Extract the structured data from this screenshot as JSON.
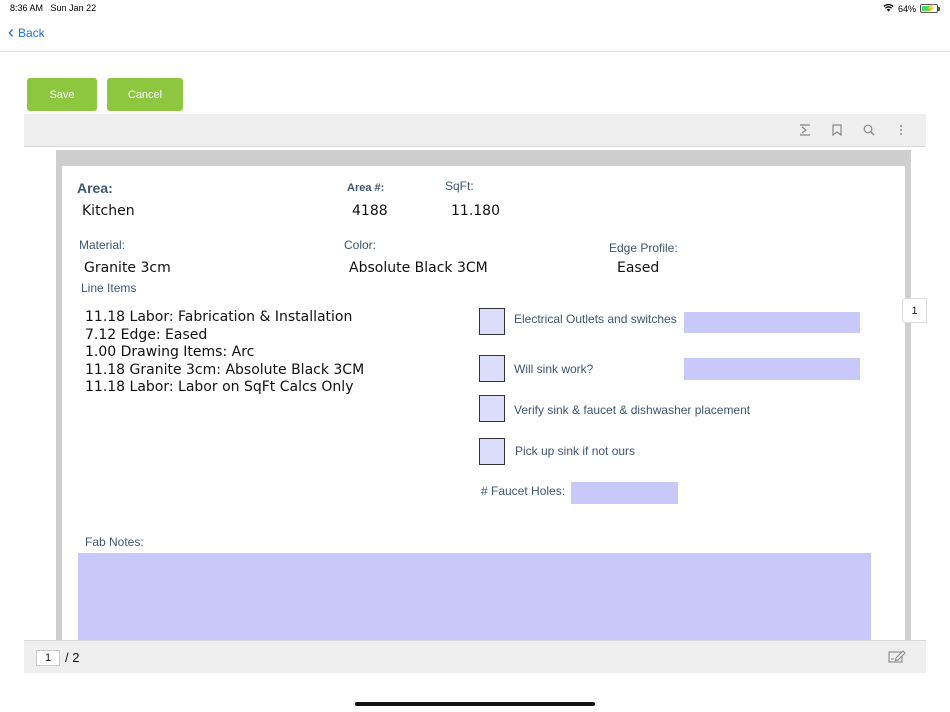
{
  "status_bar": {
    "time": "8:36 AM",
    "date": "Sun Jan 22",
    "battery": "64%",
    "battery_level": 0.64
  },
  "nav": {
    "back_label": "Back"
  },
  "actions": {
    "save_label": "Save",
    "cancel_label": "Cancel"
  },
  "toolbar": {
    "icons": [
      "outline-icon",
      "bookmark-icon",
      "search-icon",
      "more-vertical-icon"
    ]
  },
  "form": {
    "area_label": "Area:",
    "area_value": "Kitchen",
    "area_num_label": "Area #:",
    "area_num_value": "4188",
    "sqft_label": "SqFt:",
    "sqft_value": "11.180",
    "material_label": "Material:",
    "material_value": "Granite 3cm",
    "color_label": "Color:",
    "color_value": "Absolute Black 3CM",
    "edge_label": "Edge Profile:",
    "edge_value": "Eased",
    "line_items_label": "Line Items",
    "line_items": [
      "11.18 Labor: Fabrication & Installation",
      "7.12 Edge: Eased",
      "1.00 Drawing Items: Arc",
      "11.18 Granite 3cm: Absolute Black 3CM",
      "11.18 Labor: Labor on SqFt Calcs Only"
    ],
    "checks": [
      {
        "label": "Electrical Outlets and switches"
      },
      {
        "label": "Will sink work?"
      },
      {
        "label": "Verify sink & faucet & dishwasher placement"
      },
      {
        "label": "Pick up sink if not ours"
      }
    ],
    "faucet_label": "# Faucet Holes:",
    "fab_notes_label": "Fab Notes:"
  },
  "pager": {
    "current": "1",
    "total": "/ 2",
    "badge": "1"
  },
  "colors": {
    "accent_green": "#8dc63f",
    "field_fill": "#c8c8fb",
    "link_blue": "#1f6fd1"
  }
}
